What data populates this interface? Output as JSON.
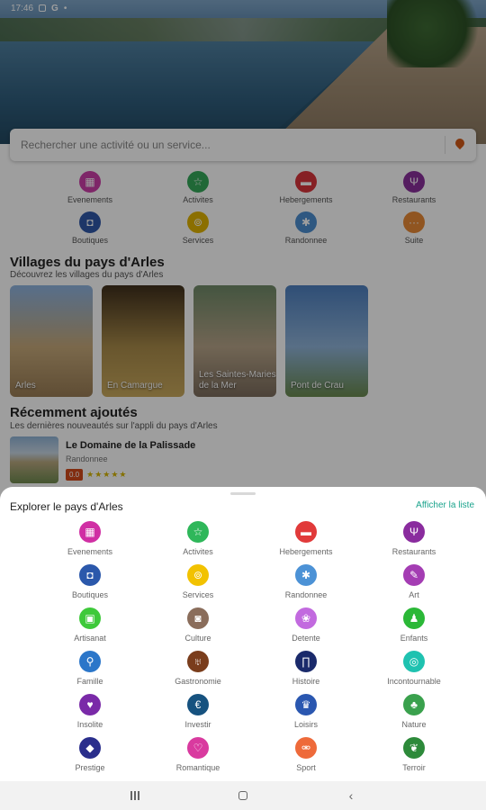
{
  "status_bar": {
    "time": "17:46",
    "icons": [
      "G-icon",
      "dot-icon"
    ]
  },
  "search": {
    "placeholder": "Rechercher une activité ou un service..."
  },
  "background_categories": [
    {
      "label": "Evenements",
      "icon": "calendar-icon",
      "glyph": "▦",
      "color": "#cc3ea8"
    },
    {
      "label": "Activites",
      "icon": "star-icon",
      "glyph": "☆",
      "color": "#35a85a"
    },
    {
      "label": "Hebergements",
      "icon": "bed-icon",
      "glyph": "▬",
      "color": "#d8343a"
    },
    {
      "label": "Restaurants",
      "icon": "fork-knife-icon",
      "glyph": "Ψ",
      "color": "#8a2f9c"
    },
    {
      "label": "Boutiques",
      "icon": "bag-icon",
      "glyph": "◘",
      "color": "#2f57a8"
    },
    {
      "label": "Services",
      "icon": "car-icon",
      "glyph": "⊚",
      "color": "#e0b300"
    },
    {
      "label": "Randonnee",
      "icon": "hiker-icon",
      "glyph": "✱",
      "color": "#4d8fd0"
    },
    {
      "label": "Suite",
      "icon": "more-icon",
      "glyph": "···",
      "color": "#e88a36"
    }
  ],
  "villages": {
    "title": "Villages du pays d'Arles",
    "subtitle": "Découvrez les villages du pays d'Arles",
    "items": [
      {
        "label": "Arles",
        "colors": [
          "#8db3e0",
          "#c6a97a",
          "#9a7d55"
        ]
      },
      {
        "label": "En Camargue",
        "colors": [
          "#3f2f1c",
          "#a98b4a",
          "#c9a95d"
        ]
      },
      {
        "label": "Les Saintes-Maries de la Mer",
        "colors": [
          "#6f8a68",
          "#b7a489",
          "#7c6d5d"
        ]
      },
      {
        "label": "Pont de Crau",
        "colors": [
          "#4d7fbf",
          "#8fb3d8",
          "#6a8a4e"
        ]
      }
    ]
  },
  "recent": {
    "title": "Récemment ajoutés",
    "subtitle": "Les dernières nouveautés sur l'appli du pays d'Arles",
    "item": {
      "name": "Le Domaine de la Palissade",
      "type": "Randonnee",
      "rating": "0.0",
      "stars": "★★★★★"
    }
  },
  "sheet": {
    "title": "Explorer le pays d'Arles",
    "link": "Afficher la liste",
    "categories": [
      {
        "label": "Evenements",
        "icon": "calendar-icon",
        "glyph": "▦",
        "color": "#d02fa4"
      },
      {
        "label": "Activites",
        "icon": "star-icon",
        "glyph": "☆",
        "color": "#2fb75a"
      },
      {
        "label": "Hebergements",
        "icon": "bed-icon",
        "glyph": "▬",
        "color": "#e13a3a"
      },
      {
        "label": "Restaurants",
        "icon": "fork-knife-icon",
        "glyph": "Ψ",
        "color": "#8a2c9e"
      },
      {
        "label": "Boutiques",
        "icon": "bag-icon",
        "glyph": "◘",
        "color": "#2b58ab"
      },
      {
        "label": "Services",
        "icon": "car-icon",
        "glyph": "⊚",
        "color": "#f2c200"
      },
      {
        "label": "Randonnee",
        "icon": "hiker-icon",
        "glyph": "✱",
        "color": "#4c92d6"
      },
      {
        "label": "Art",
        "icon": "brush-icon",
        "glyph": "✎",
        "color": "#a43db3"
      },
      {
        "label": "Artisanat",
        "icon": "basket-icon",
        "glyph": "▣",
        "color": "#3ec93a"
      },
      {
        "label": "Culture",
        "icon": "camera-icon",
        "glyph": "◙",
        "color": "#8a6d5b"
      },
      {
        "label": "Detente",
        "icon": "lotus-icon",
        "glyph": "❀",
        "color": "#c26adf"
      },
      {
        "label": "Enfants",
        "icon": "shirt-icon",
        "glyph": "♟",
        "color": "#2bb837"
      },
      {
        "label": "Famille",
        "icon": "family-icon",
        "glyph": "⚲",
        "color": "#2b76c9"
      },
      {
        "label": "Gastronomie",
        "icon": "wine-icon",
        "glyph": "♅",
        "color": "#7a3d1c"
      },
      {
        "label": "Histoire",
        "icon": "arch-icon",
        "glyph": "∏",
        "color": "#1a2a6b"
      },
      {
        "label": "Incontournable",
        "icon": "target-icon",
        "glyph": "◎",
        "color": "#1fc2b0"
      },
      {
        "label": "Insolite",
        "icon": "pin-heart-icon",
        "glyph": "♥",
        "color": "#7a2aa8"
      },
      {
        "label": "Investir",
        "icon": "euro-icon",
        "glyph": "€",
        "color": "#16527f"
      },
      {
        "label": "Loisirs",
        "icon": "crown-icon",
        "glyph": "♛",
        "color": "#2a57b0"
      },
      {
        "label": "Nature",
        "icon": "tree-icon",
        "glyph": "♣",
        "color": "#3aa14d"
      },
      {
        "label": "Prestige",
        "icon": "diamond-icon",
        "glyph": "◆",
        "color": "#2a2e8c"
      },
      {
        "label": "Romantique",
        "icon": "heart-icon",
        "glyph": "♡",
        "color": "#d93a9f"
      },
      {
        "label": "Sport",
        "icon": "bike-icon",
        "glyph": "⚮",
        "color": "#ee6a3a"
      },
      {
        "label": "Terroir",
        "icon": "leaf-icon",
        "glyph": "❦",
        "color": "#2d8a3a"
      }
    ]
  },
  "nav": {
    "back_glyph": "‹"
  }
}
